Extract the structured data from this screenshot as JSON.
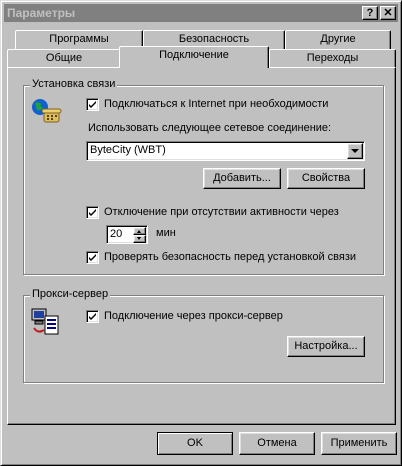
{
  "window": {
    "title": "Параметры",
    "help_glyph": "?",
    "close_glyph": "✕"
  },
  "tabs": {
    "back_row": [
      "Программы",
      "Безопасность",
      "Другие"
    ],
    "front_row": [
      "Общие",
      "Подключение",
      "Переходы"
    ],
    "active": "Подключение"
  },
  "connection": {
    "group_label": "Установка связи",
    "connect_checkbox": {
      "label": "Подключаться к Internet при необходимости",
      "checked": true
    },
    "use_connection_label": "Использовать следующее сетевое соединение:",
    "connection_select_value": "ByteCity (WBT)",
    "add_button": "Добавить...",
    "properties_button": "Свойства",
    "disconnect_checkbox": {
      "label": "Отключение при отсутствии активности через",
      "checked": true
    },
    "idle_minutes": "20",
    "minutes_unit": "мин",
    "security_checkbox": {
      "label": "Проверять безопасность перед установкой связи",
      "checked": true
    }
  },
  "proxy": {
    "group_label": "Прокси-сервер",
    "proxy_checkbox": {
      "label": "Подключение через прокси-сервер",
      "checked": true
    },
    "settings_button": "Настройка..."
  },
  "footer": {
    "ok": "OK",
    "cancel": "Отмена",
    "apply": "Применить"
  },
  "colors": {
    "face": "#c0c0c0",
    "inactive_titlebar": "#808080",
    "inactive_title_text": "#c0c0c0"
  }
}
